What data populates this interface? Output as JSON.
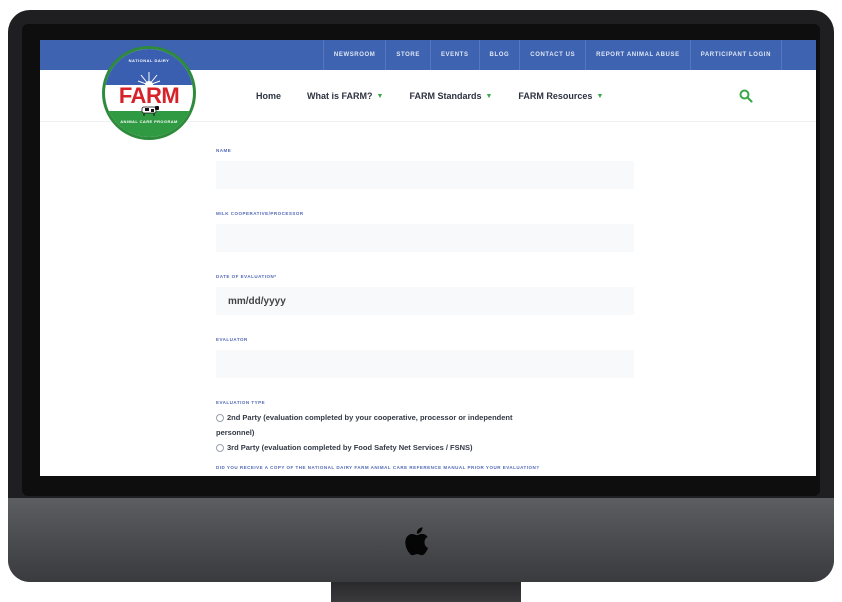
{
  "topbar": {
    "links": [
      "NEWSROOM",
      "STORE",
      "EVENTS",
      "BLOG",
      "CONTACT US",
      "REPORT ANIMAL ABUSE",
      "PARTICIPANT LOGIN"
    ]
  },
  "logo": {
    "arc_top": "NATIONAL DAIRY",
    "brand": "FARM",
    "arc_bottom": "ANIMAL CARE PROGRAM"
  },
  "nav": {
    "items": [
      {
        "label": "Home",
        "has_dropdown": false
      },
      {
        "label": "What is FARM?",
        "has_dropdown": true
      },
      {
        "label": "FARM Standards",
        "has_dropdown": true
      },
      {
        "label": "FARM Resources",
        "has_dropdown": true
      }
    ],
    "search_icon": "search-icon"
  },
  "form": {
    "name_label": "NAME",
    "name_value": "",
    "coop_label": "MILK COOPERATIVE/PROCESSOR",
    "coop_value": "",
    "date_label": "DATE OF EVALUATION*",
    "date_placeholder": "mm/dd/yyyy",
    "evaluator_label": "EVALUATOR",
    "evaluator_value": "",
    "eval_type_label": "EVALUATION TYPE",
    "eval_type_options": [
      "2nd Party (evaluation completed by your cooperative, processor or independent",
      "personnel)",
      "3rd Party (evaluation completed by Food Safety Net Services / FSNS)"
    ],
    "manual_question": "DID YOU RECEIVE A COPY OF THE NATIONAL DAIRY FARM ANIMAL CARE REFERENCE MANUAL PRIOR YOUR EVALUATION?"
  },
  "colors": {
    "topbar": "#3e63b0",
    "accent_green": "#3aa84a",
    "label_blue": "#5168b5",
    "brand_red": "#d6232a"
  },
  "device": {
    "hardware_logo": "apple-icon"
  }
}
